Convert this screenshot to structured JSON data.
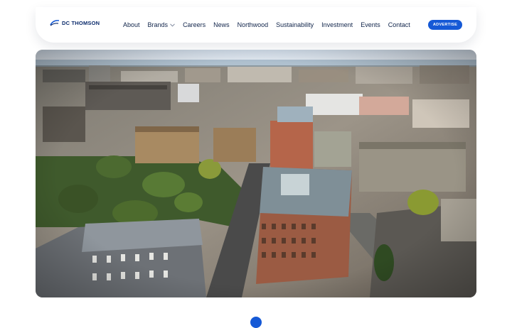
{
  "brand": {
    "logo_text": "DC THOMSON",
    "accent": "#1559d6"
  },
  "nav": {
    "items": [
      {
        "label": "About",
        "dropdown": false
      },
      {
        "label": "Brands",
        "dropdown": true
      },
      {
        "label": "Careers",
        "dropdown": false
      },
      {
        "label": "News",
        "dropdown": false
      },
      {
        "label": "Northwood",
        "dropdown": false
      },
      {
        "label": "Sustainability",
        "dropdown": false
      },
      {
        "label": "Investment",
        "dropdown": false
      },
      {
        "label": "Events",
        "dropdown": false
      },
      {
        "label": "Contact",
        "dropdown": false
      }
    ],
    "cta_label": "ADVERTISE"
  },
  "hero": {
    "icon": "aerial-city-photo"
  }
}
